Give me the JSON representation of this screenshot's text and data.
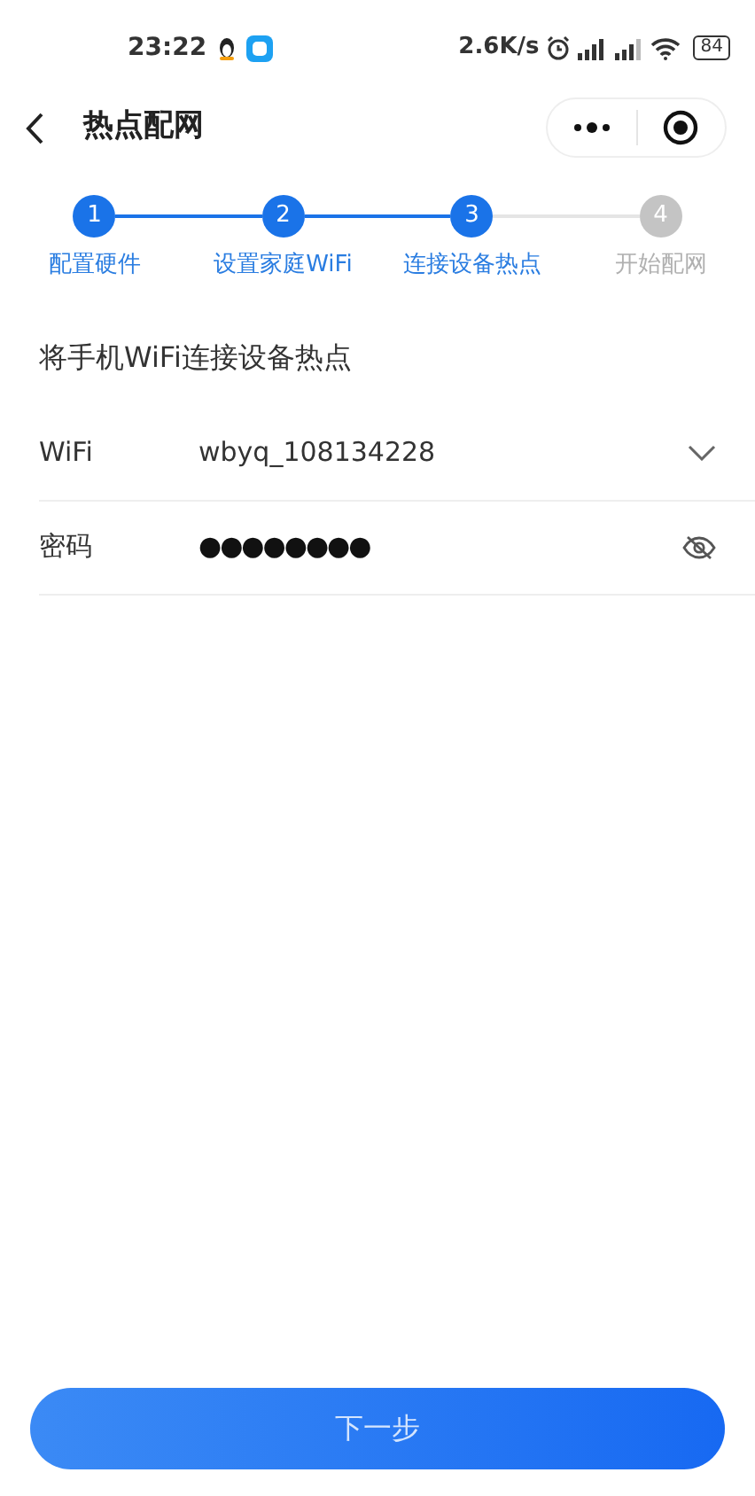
{
  "status_bar": {
    "time": "23:22",
    "speed": "2.6K/s",
    "battery": "84"
  },
  "header": {
    "title": "热点配网"
  },
  "steps": [
    {
      "number": "1",
      "label": "配置硬件",
      "done": true
    },
    {
      "number": "2",
      "label": "设置家庭WiFi",
      "done": true
    },
    {
      "number": "3",
      "label": "连接设备热点",
      "done": true
    },
    {
      "number": "4",
      "label": "开始配网",
      "done": false
    }
  ],
  "section_title": "将手机WiFi连接设备热点",
  "form": {
    "wifi": {
      "label": "WiFi",
      "value": "wbyq_108134228"
    },
    "password": {
      "label": "密码",
      "value": "●●●●●●●●",
      "visible": false
    }
  },
  "next_button": "下一步"
}
